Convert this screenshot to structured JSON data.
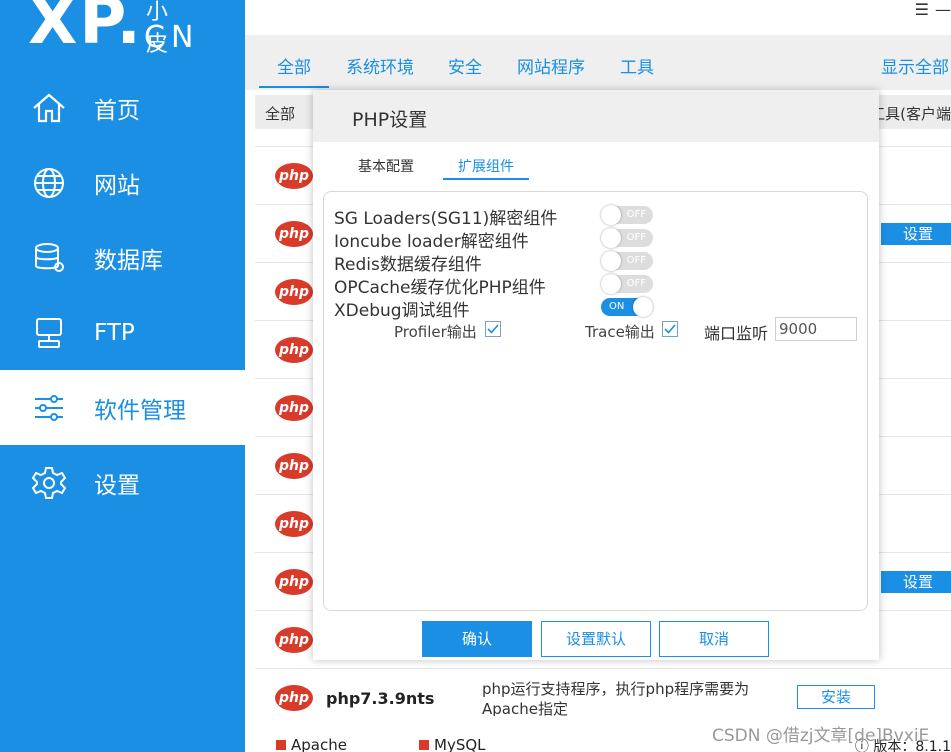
{
  "logo": {
    "main": "XP.",
    "small": "小皮",
    "cn": "CN"
  },
  "sidebar": {
    "items": [
      {
        "label": "首页",
        "icon": "home-icon"
      },
      {
        "label": "网站",
        "icon": "globe-icon"
      },
      {
        "label": "数据库",
        "icon": "database-icon"
      },
      {
        "label": "FTP",
        "icon": "ftp-monitor-icon"
      },
      {
        "label": "软件管理",
        "icon": "sliders-icon",
        "active": true
      },
      {
        "label": "设置",
        "icon": "gear-icon"
      }
    ]
  },
  "topbar": {
    "menu_glyph": "☰",
    "minimize_glyph": "—"
  },
  "tabs": {
    "items": [
      "全部",
      "系统环境",
      "安全",
      "网站程序",
      "工具"
    ],
    "show_all": "显示全部"
  },
  "list": {
    "header_left": "全部",
    "header_right": "工具(客户端",
    "badge": "php",
    "set_label": "设置",
    "install_label": "安装",
    "last_row": {
      "name": "php7.3.9nts",
      "desc": "php运行支持程序，执行php程序需要为Apache指定"
    }
  },
  "status": {
    "apache": "Apache",
    "mysql": "MySQL",
    "version": "ⓘ 版本：8.1.1"
  },
  "watermark": "CSDN @借zj文章[de]BvxiE",
  "modal": {
    "title": "PHP设置",
    "tabs": [
      "基本配置",
      "扩展组件"
    ],
    "components": [
      {
        "name": "SG Loaders(SG11)解密组件",
        "state": "OFF"
      },
      {
        "name": "Ioncube loader解密组件",
        "state": "OFF"
      },
      {
        "name": "Redis数据缓存组件",
        "state": "OFF"
      },
      {
        "name": "OPCache缓存优化PHP组件",
        "state": "OFF"
      },
      {
        "name": "XDebug调试组件",
        "state": "ON"
      }
    ],
    "profiler_label": "Profiler输出",
    "trace_label": "Trace输出",
    "port_label": "端口监听",
    "port_value": "9000",
    "buttons": {
      "confirm": "确认",
      "set_default": "设置默认",
      "cancel": "取消"
    }
  },
  "colors": {
    "accent": "#1a8fe3",
    "php_badge": "#d93b2b"
  }
}
